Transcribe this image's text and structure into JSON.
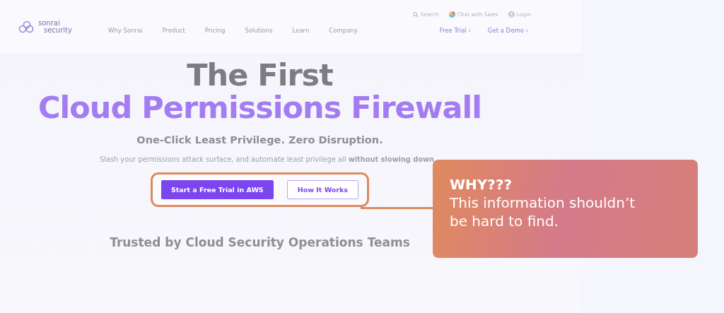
{
  "header": {
    "logo": {
      "line1": "sonrai",
      "line2": "security"
    },
    "nav": [
      "Why Sonrai",
      "Product",
      "Pricing",
      "Solutions",
      "Learn",
      "Company"
    ],
    "utility": [
      {
        "kind": "search",
        "label": "Search"
      },
      {
        "kind": "chat",
        "label": "Chat with Sales"
      },
      {
        "kind": "user",
        "label": "Login"
      }
    ],
    "cta_links": [
      {
        "label": "Free Trial",
        "chevron": "›"
      },
      {
        "label": "Get a Demo",
        "chevron": "›"
      }
    ]
  },
  "hero": {
    "title_line1": "The First",
    "title_line2": "Cloud Permissions Firewall",
    "tagline": "One-Click Least Privilege. Zero Disruption.",
    "description": "Slash your permissions attack surface, and automate least privilege all **without slowing down**",
    "buttons": [
      {
        "label": "Start a Free Trial in AWS",
        "kind": "primary"
      },
      {
        "label": "How It Works",
        "kind": "outline"
      }
    ],
    "trusted": "Trusted by Cloud Security Operations Teams"
  },
  "callout": {
    "title": "WHY???",
    "text": "This information shouldn’t be hard to find."
  }
}
